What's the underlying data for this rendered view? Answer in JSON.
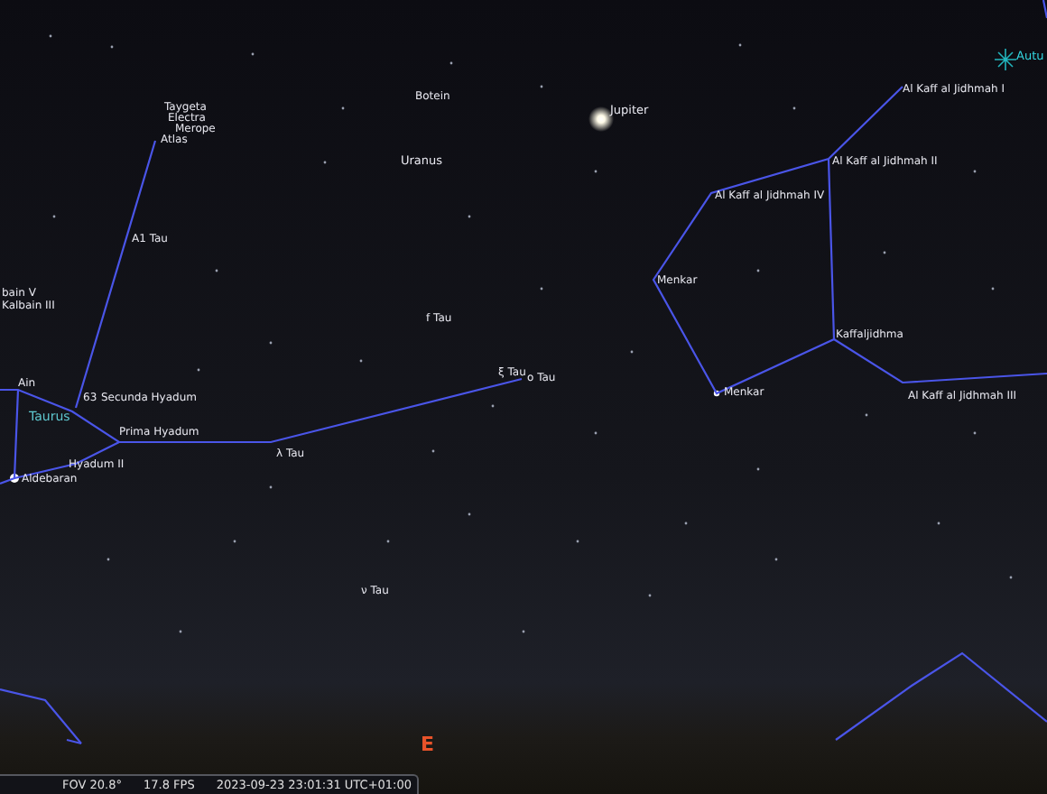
{
  "sky_labels": [
    {
      "kind": "star",
      "text": "Taygeta"
    },
    {
      "kind": "star",
      "text": "Electra"
    },
    {
      "kind": "star",
      "text": "Merope"
    },
    {
      "kind": "star",
      "text": "Atlas"
    },
    {
      "kind": "star",
      "text": "Botein"
    },
    {
      "kind": "planet",
      "text": "Jupiter"
    },
    {
      "kind": "planet",
      "text": "Uranus"
    },
    {
      "kind": "radiant",
      "text": "Autu"
    },
    {
      "kind": "star",
      "text": "Al Kaff al Jidhmah I"
    },
    {
      "kind": "star",
      "text": "Al Kaff al Jidhmah II"
    },
    {
      "kind": "star",
      "text": "Al Kaff al Jidhmah IV"
    },
    {
      "kind": "star",
      "text": "A1 Tau"
    },
    {
      "kind": "star",
      "text": "Menkar"
    },
    {
      "kind": "star",
      "text": "bain V"
    },
    {
      "kind": "star",
      "text": "Kalbain III"
    },
    {
      "kind": "star",
      "text": "f Tau"
    },
    {
      "kind": "star",
      "text": "Kaffaljidhma"
    },
    {
      "kind": "star",
      "text": "Ain"
    },
    {
      "kind": "star",
      "text": "ξ Tau"
    },
    {
      "kind": "star",
      "text": "ο Tau"
    },
    {
      "kind": "star",
      "text": "63"
    },
    {
      "kind": "star",
      "text": "Secunda Hyadum"
    },
    {
      "kind": "star",
      "text": "Menkar"
    },
    {
      "kind": "star",
      "text": "Al Kaff al Jidhmah III"
    },
    {
      "kind": "constellation",
      "text": "Taurus"
    },
    {
      "kind": "star",
      "text": "Prima Hyadum"
    },
    {
      "kind": "star",
      "text": "λ Tau"
    },
    {
      "kind": "star",
      "text": "Hyadum II"
    },
    {
      "kind": "star",
      "text": "Aldebaran"
    },
    {
      "kind": "star",
      "text": "ν Tau"
    },
    {
      "kind": "cardinal",
      "text": "E"
    }
  ],
  "status_bar": {
    "fov": "FOV 20.8°",
    "fps": "17.8 FPS",
    "datetime": "2023-09-23 23:01:31 UTC+01:00"
  }
}
